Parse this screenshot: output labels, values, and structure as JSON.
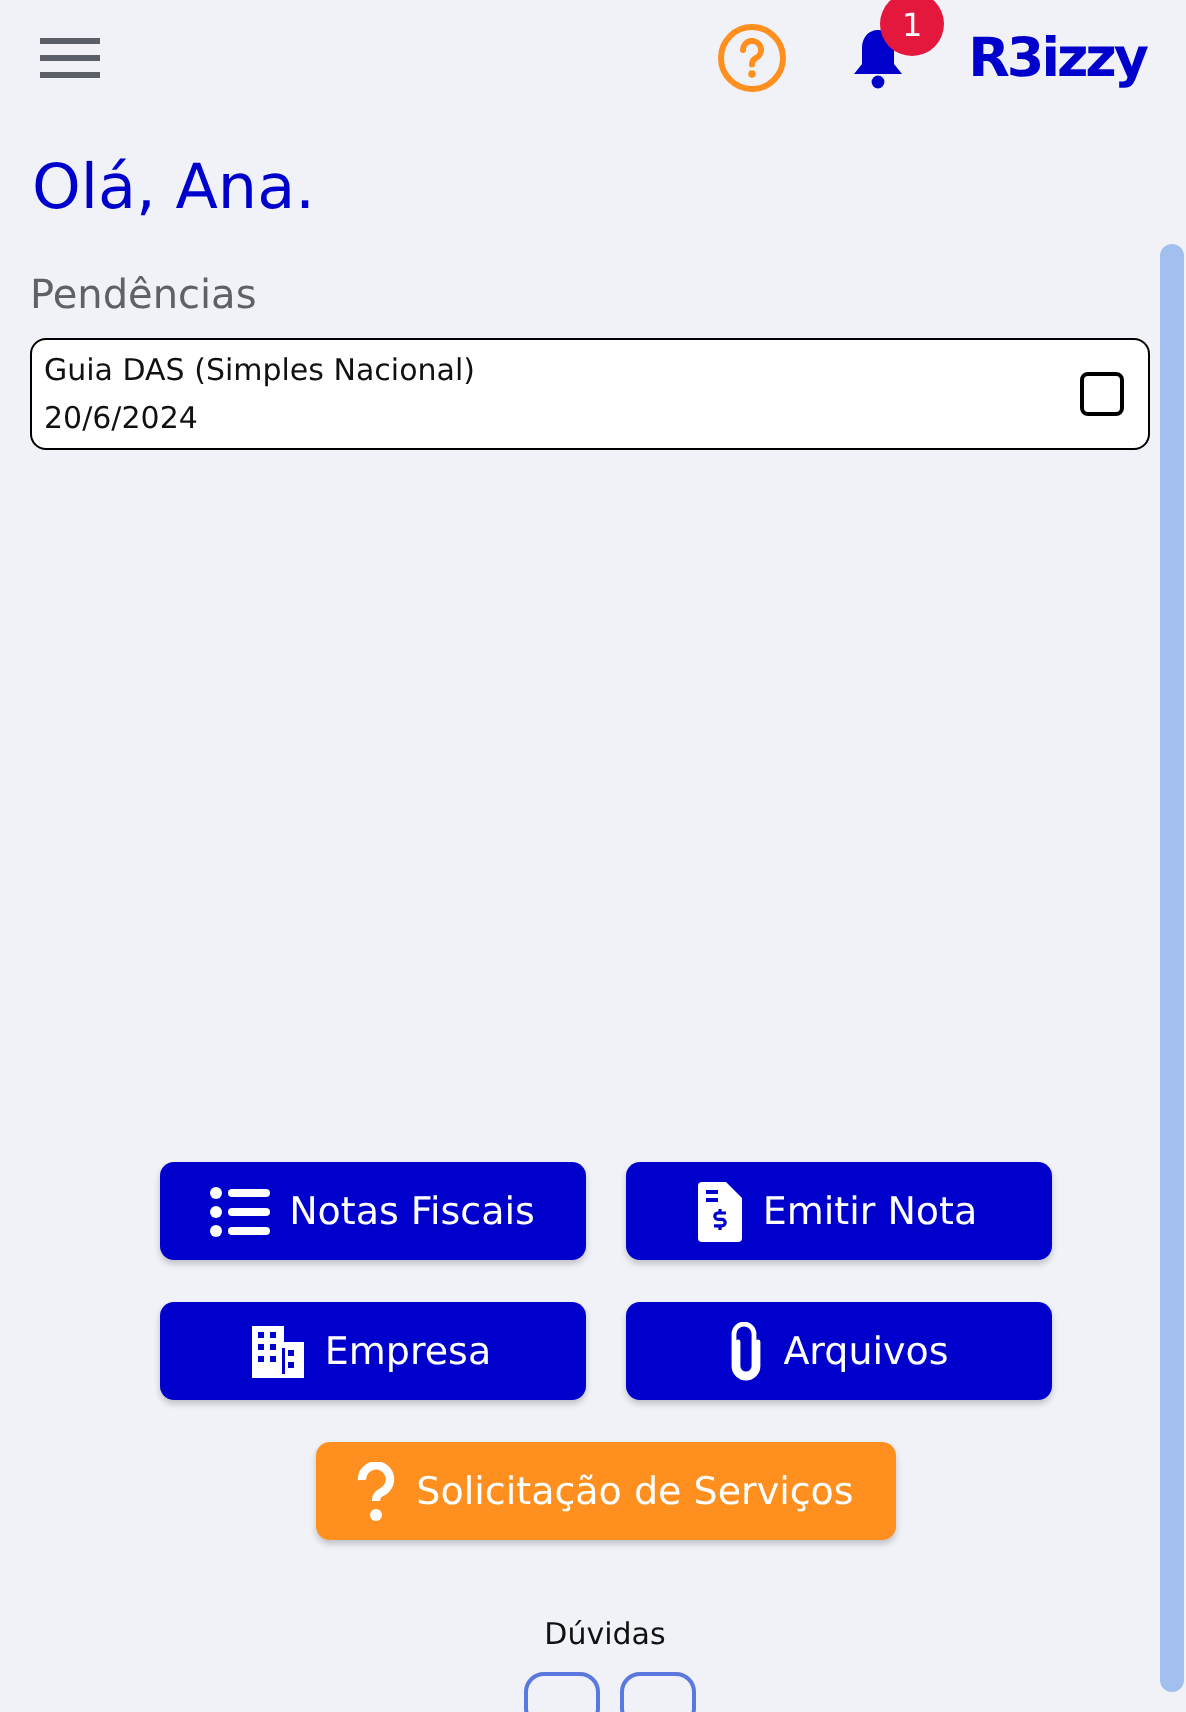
{
  "header": {
    "logo": "R3izzy",
    "notification_count": "1"
  },
  "greeting": "Olá, Ana.",
  "pending": {
    "title": "Pendências",
    "items": [
      {
        "title": "Guia DAS (Simples Nacional)",
        "date": "20/6/2024",
        "checked": false
      }
    ]
  },
  "actions": [
    {
      "label": "Notas Fiscais",
      "kind": "list"
    },
    {
      "label": "Emitir Nota",
      "kind": "invoice"
    },
    {
      "label": "Empresa",
      "kind": "building"
    },
    {
      "label": "Arquivos",
      "kind": "attachment"
    },
    {
      "label": "Solicitação de Serviços",
      "kind": "request"
    }
  ],
  "help": {
    "title": "Dúvidas"
  }
}
